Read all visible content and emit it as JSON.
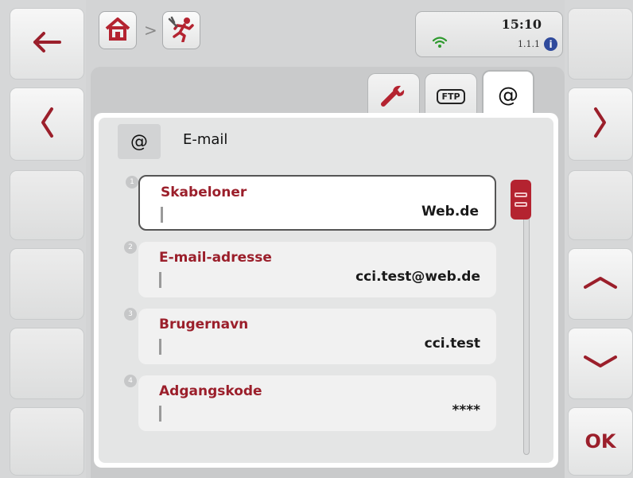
{
  "header": {
    "home_icon": "home-icon",
    "breadcrumb_separator": ">",
    "app_icon": "service-icon",
    "status": {
      "time": "15:10",
      "version": "1.1.1",
      "info_symbol": "i",
      "wifi_color": "#2e9a2e"
    }
  },
  "left_softkeys": [
    {
      "icon": "arrow-left-icon"
    },
    {
      "icon": "chevron-left-icon"
    }
  ],
  "right_softkeys": {
    "next_icon": "chevron-right-icon",
    "up_icon": "chevron-up-icon",
    "down_icon": "chevron-down-icon",
    "ok_label": "OK"
  },
  "tabs": [
    {
      "icon": "wrench-icon",
      "label": ""
    },
    {
      "icon": "ftp-icon",
      "label": "FTP"
    },
    {
      "icon": "at-icon",
      "label": "@",
      "active": true
    }
  ],
  "panel": {
    "title_icon": "@",
    "title": "E-mail",
    "fields": [
      {
        "number": "1",
        "label": "Skabeloner",
        "value": "Web.de",
        "selected": true
      },
      {
        "number": "2",
        "label": "E-mail-adresse",
        "value": "cci.test@web.de"
      },
      {
        "number": "3",
        "label": "Brugernavn",
        "value": "cci.test"
      },
      {
        "number": "4",
        "label": "Adgangskode",
        "value": "****"
      }
    ]
  },
  "colors": {
    "accent": "#9b1f2b",
    "scroll_thumb": "#b42330",
    "info_dot": "#2f4a9c"
  }
}
